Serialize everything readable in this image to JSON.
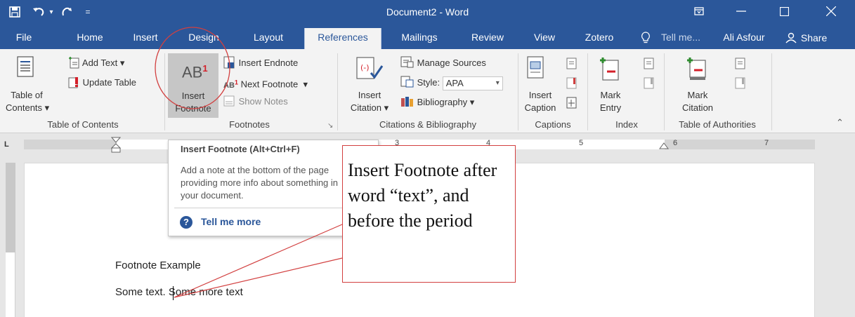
{
  "titlebar": {
    "title": "Document2 - Word",
    "save_icon": "save-icon",
    "undo_icon": "undo-icon",
    "redo_icon": "redo-icon",
    "customize_icon": "customize-qat-icon",
    "ribbon_display_icon": "ribbon-display-options-icon",
    "minimize_icon": "minimize-icon",
    "maximize_icon": "maximize-icon",
    "close_icon": "close-icon"
  },
  "tabs": {
    "file": "File",
    "home": "Home",
    "insert": "Insert",
    "design": "Design",
    "layout": "Layout",
    "references": "References",
    "mailings": "Mailings",
    "review": "Review",
    "view": "View",
    "zotero": "Zotero",
    "tell_me": "Tell me...",
    "user": "Ali Asfour",
    "share": "Share"
  },
  "ribbon": {
    "toc": {
      "table_of_line1": "Table of",
      "table_of_line2": "Contents",
      "add_text": "Add Text",
      "update_table": "Update Table",
      "group_label": "Table of Contents"
    },
    "footnotes": {
      "ab_glyph": "AB",
      "ab_sup": "1",
      "insert_footnote_line1": "Insert",
      "insert_footnote_line2": "Footnote",
      "insert_endnote": "Insert Endnote",
      "next_footnote": "Next Footnote",
      "show_notes": "Show Notes",
      "group_label": "Footnotes"
    },
    "citations": {
      "manage_sources": "Manage Sources",
      "style_label": "Style:",
      "style_value": "APA",
      "insert_citation_line1": "Insert",
      "insert_citation_line2": "Citation",
      "bibliography": "Bibliography",
      "group_label": "Citations & Bibliography"
    },
    "captions": {
      "insert_caption_line1": "Insert",
      "insert_caption_line2": "Caption",
      "group_label": "Captions"
    },
    "index": {
      "mark_entry_line1": "Mark",
      "mark_entry_line2": "Entry",
      "group_label": "Index"
    },
    "authorities": {
      "mark_citation_line1": "Mark",
      "mark_citation_line2": "Citation",
      "group_label": "Table of Authorities"
    }
  },
  "ruler": {
    "n3": "3",
    "n4": "4",
    "n5": "5",
    "n6": "6",
    "n7": "7"
  },
  "tooltip": {
    "title": "Insert Footnote (Alt+Ctrl+F)",
    "description": "Add a note at the bottom of the page providing more info about something in your document.",
    "tell_me_more": "Tell me more"
  },
  "document": {
    "heading": "Footnote Example",
    "line": "Some text. Some more text"
  },
  "callout": {
    "text": "Insert Footnote after word “text”, and before the period"
  },
  "colors": {
    "word_blue": "#2b579a",
    "annotation_red": "#d24040"
  }
}
